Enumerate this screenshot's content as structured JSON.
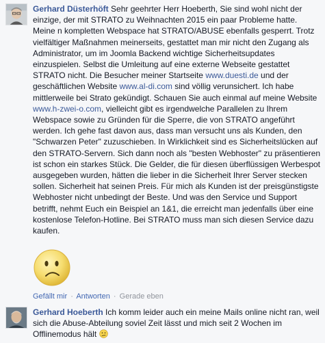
{
  "comments": [
    {
      "author": "Gerhard Düsterhöft",
      "text_parts": [
        " Sehr geehrter Herr Hoeberth, Sie sind wohl nicht der einzige, der mit STRATO zu Weihnachten 2015 ein paar Probleme hatte. Meine n kompletten Webspace hat STRATO/ABUSE ebenfalls gesperrt. Trotz vielfältiger Maßnahmen meinerseits, gestattet man mir nicht den Zugang als Administrator, um im Joomla Backend wichtige Sicherheitsupdates einzuspielen. Selbst die Umleitung auf eine externe Webseite gestattet STRATO nicht. Die Besucher meiner Startseite ",
        " und der geschäftlichen Website ",
        " sind völlig verunsichert. Ich habe mittlerweile bei Strato gekündigt. Schauen Sie auch einmal auf meine Website ",
        ", vielleicht gibt es irgendwelche Parallelen zu Ihrem Webspace sowie zu Gründen für die Sperre, die von STRATO angeführt werden. Ich gehe fast davon aus, dass man versucht uns als Kunden, den \"Schwarzen Peter\" zuzuschieben. In Wirklichkeit sind es Sicherheitslücken auf den STRATO-Servern. Sich dann noch als \"besten Webhoster\" zu präsentieren ist schon ein starkes Stück. Die Gelder, die für diesen überflüssigen Werbespot ausgegeben wurden, hätten die lieber in die Sicherheit Ihrer Server stecken sollen. Sicherheit hat seinen Preis. Für mich als Kunden ist der preisgünstigste Webhoster nicht unbedingt der Beste. Und was den Service und Support betrifft, nehmt Euch ein Beispiel an 1&1, die erreicht man jedenfalls über eine kostenlose Telefon-Hotline. Bei STRATO muss man sich diesen Service dazu kaufen."
      ],
      "links": [
        "www.duesti.de",
        "www.al-di.com",
        "www.h-zwei-o.com"
      ],
      "attachment_icon": "sad-face-sticker-icon",
      "actions": {
        "like": "Gefällt mir",
        "reply": "Antworten",
        "timestamp": "Gerade eben",
        "separator": "·"
      }
    },
    {
      "author": "Gerhard Hoeberth",
      "text": " Ich komm leider auch ein meine Mails online nicht ran, weil sich die Abuse-Abteilung soviel Zeit lässt und mich seit 2 Wochen im Offlinemodus hält",
      "emoji_icon": "confused-face-emoji-icon"
    }
  ],
  "colors": {
    "author": "#3b5998",
    "text": "#141823",
    "meta": "#90949c",
    "action": "#4267b2",
    "background": "#f6f7f9"
  }
}
